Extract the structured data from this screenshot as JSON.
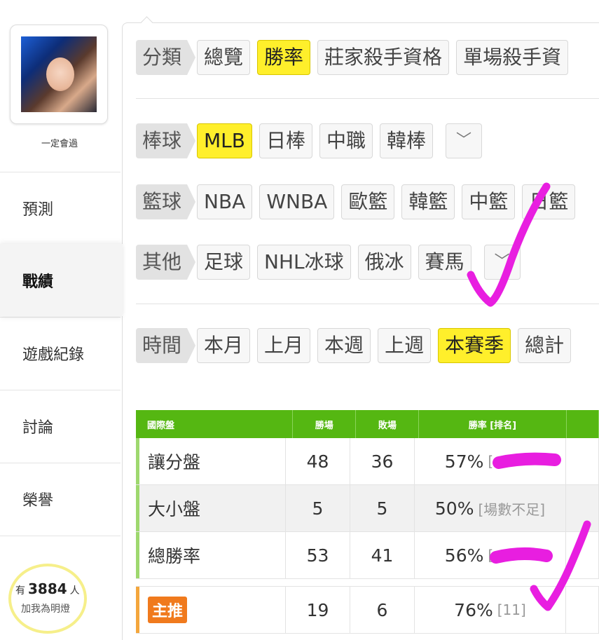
{
  "sidebar": {
    "username": "一定會過",
    "nav": [
      "預測",
      "戰績",
      "遊戲紀錄",
      "討論",
      "榮譽"
    ],
    "active": "戰績",
    "light": {
      "prefix": "有",
      "count": "3884",
      "suffix": "人",
      "label": "加我為明燈"
    }
  },
  "filters": {
    "category": {
      "label": "分類",
      "chips": [
        "總覽",
        "勝率",
        "莊家殺手資格",
        "單場殺手資"
      ],
      "selected": "勝率"
    },
    "baseball": {
      "label": "棒球",
      "chips": [
        "MLB",
        "日棒",
        "中職",
        "韓棒"
      ],
      "selected": "MLB"
    },
    "basketball": {
      "label": "籃球",
      "chips": [
        "NBA",
        "WNBA",
        "歐籃",
        "韓籃",
        "中籃",
        "日籃"
      ]
    },
    "other": {
      "label": "其他",
      "chips": [
        "足球",
        "NHL冰球",
        "俄冰",
        "賽馬"
      ]
    },
    "time": {
      "label": "時間",
      "chips": [
        "本月",
        "上月",
        "本週",
        "上週",
        "本賽季",
        "總計"
      ],
      "selected": "本賽季"
    }
  },
  "table": {
    "headers": [
      "國際盤",
      "勝場",
      "敗場",
      "勝率 [排名]"
    ],
    "rows": [
      {
        "name": "讓分盤",
        "wins": "48",
        "losses": "36",
        "rate": "57%",
        "rank": "["
      },
      {
        "name": "大小盤",
        "wins": "5",
        "losses": "5",
        "rate": "50%",
        "rank": "[場數不足]"
      },
      {
        "name": "總勝率",
        "wins": "53",
        "losses": "41",
        "rate": "56%",
        "rank": "["
      }
    ],
    "featured": {
      "name": "主推",
      "wins": "19",
      "losses": "6",
      "rate": "76%",
      "rank": "[11]"
    }
  },
  "colors": {
    "accent_yellow": "#ffef2b",
    "table_green": "#55b712",
    "marker_magenta": "#e81ee0",
    "featured_orange": "#f07a1d"
  }
}
